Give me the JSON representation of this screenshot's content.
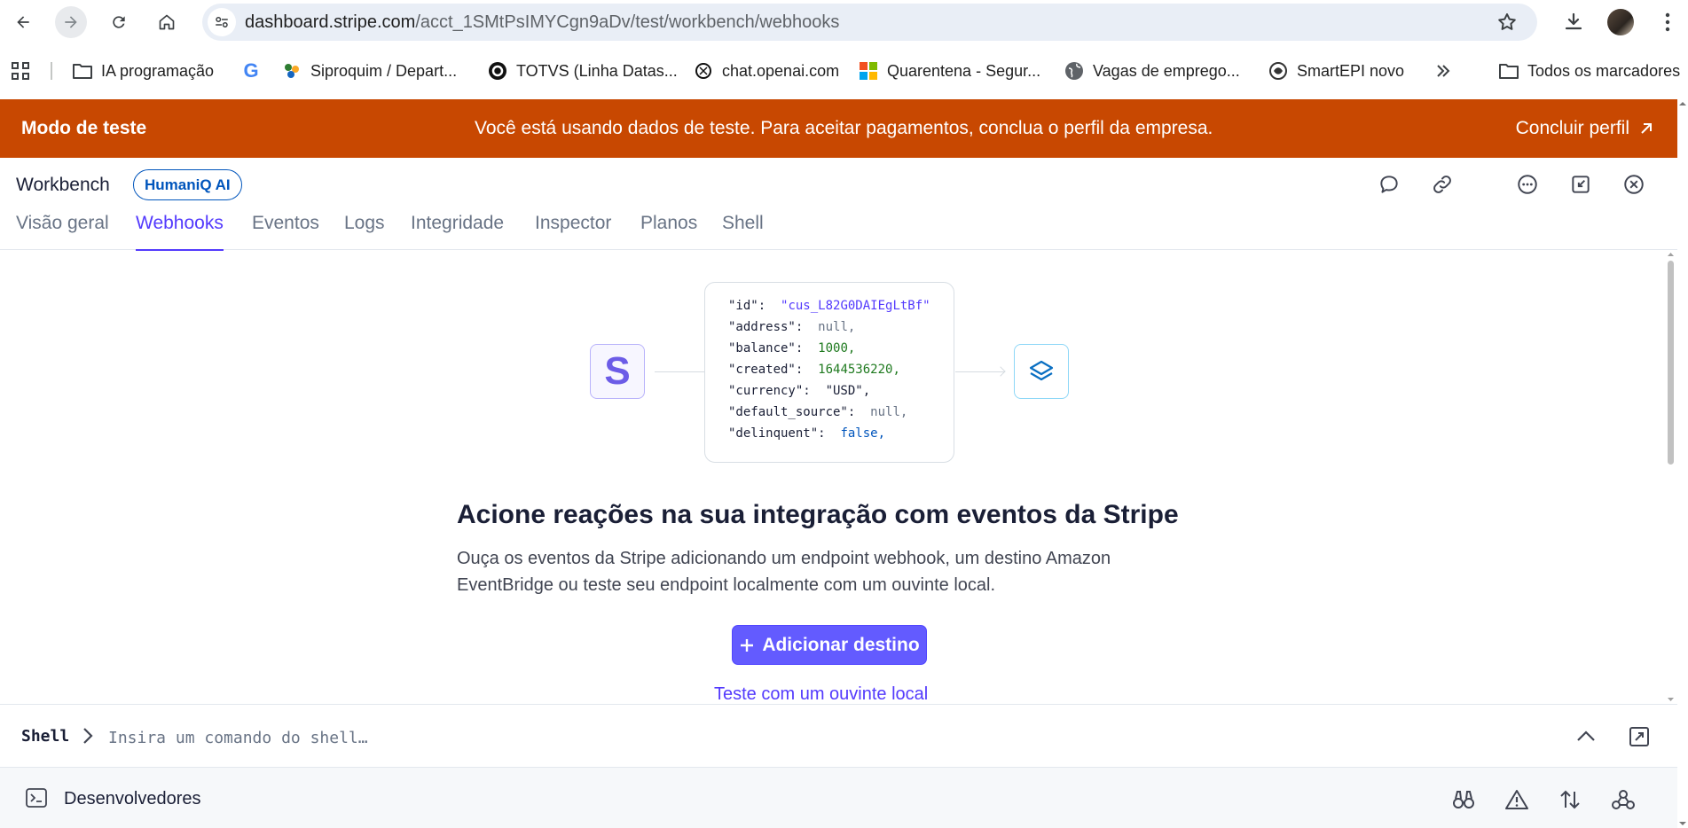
{
  "browser": {
    "url_host": "dashboard.stripe.com",
    "url_path": "/acct_1SMtPsIMYCgn9aDv/test/workbench/webhooks",
    "bookmarks": [
      {
        "label": "IA programação",
        "icon": "folder-icon"
      },
      {
        "label": "",
        "icon": "google-icon"
      },
      {
        "label": "Siproquim / Depart...",
        "icon": "siproquim-icon"
      },
      {
        "label": "TOTVS (Linha Datas...",
        "icon": "totvs-icon"
      },
      {
        "label": "chat.openai.com",
        "icon": "openai-icon"
      },
      {
        "label": "Quarentena - Segur...",
        "icon": "microsoft-icon"
      },
      {
        "label": "Vagas de emprego...",
        "icon": "globe-icon"
      },
      {
        "label": "SmartEPI novo",
        "icon": "smartepi-icon"
      }
    ],
    "all_bookmarks_label": "Todos os marcadores"
  },
  "banner": {
    "title": "Modo de teste",
    "message": "Você está usando dados de teste. Para aceitar pagamentos, conclua o perfil da empresa.",
    "link": "Concluir perfil",
    "color": "#c84801"
  },
  "workbench": {
    "title": "Workbench",
    "account_pill": "HumaniQ AI",
    "tabs": [
      "Visão geral",
      "Webhooks",
      "Eventos",
      "Logs",
      "Integridade",
      "Inspector",
      "Planos",
      "Shell"
    ],
    "active_tab": "Webhooks"
  },
  "illustration": {
    "logo_letter": "S",
    "code": {
      "id_key": "\"id\":",
      "id_val": "\"cus_L82G0DAIEgLtBf\"",
      "address_key": "\"address\":",
      "address_val": "null,",
      "balance_key": "\"balance\":",
      "balance_val": "1000,",
      "created_key": "\"created\":",
      "created_val": "1644536220,",
      "currency_key": "\"currency\":",
      "currency_val": "\"USD\",",
      "default_source_key": "\"default_source\":",
      "default_source_val": "null,",
      "delinquent_key": "\"delinquent\":",
      "delinquent_val": "false,"
    }
  },
  "empty_state": {
    "headline": "Acione reações na sua integração com eventos da Stripe",
    "description": "Ouça os eventos da Stripe adicionando um endpoint webhook, um destino Amazon EventBridge ou teste seu endpoint localmente com um ouvinte local.",
    "primary_button": "Adicionar destino",
    "secondary_link": "Teste com um ouvinte local"
  },
  "shell": {
    "label": "Shell",
    "placeholder": "Insira um comando do shell…"
  },
  "devbar": {
    "label": "Desenvolvedores"
  },
  "colors": {
    "accent": "#533afd",
    "button": "#635bff"
  }
}
